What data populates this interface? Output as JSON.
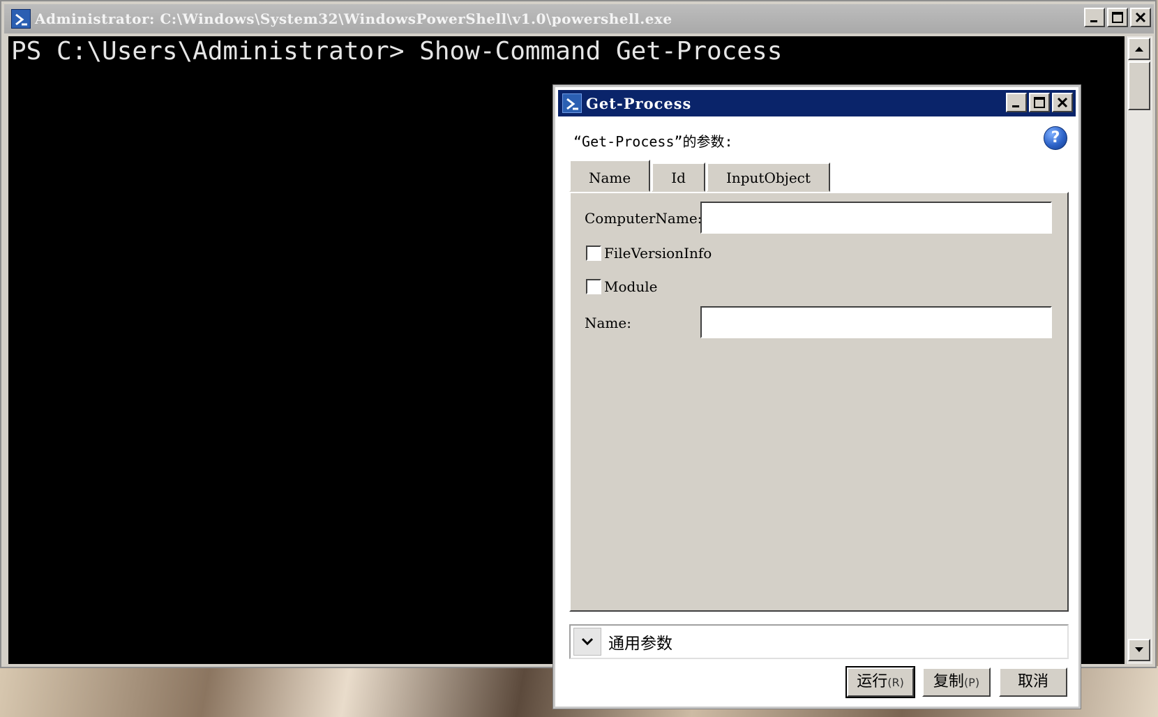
{
  "console_window": {
    "title": "Administrator: C:\\Windows\\System32\\WindowsPowerShell\\v1.0\\powershell.exe",
    "command_line": "PS C:\\Users\\Administrator> Show-Command Get-Process"
  },
  "dialog": {
    "title": "Get-Process",
    "heading": "“Get-Process”的参数:",
    "help_label": "?",
    "tabs": [
      {
        "label": "Name"
      },
      {
        "label": "Id"
      },
      {
        "label": "InputObject"
      }
    ],
    "fields": {
      "computer_name_label": "ComputerName:",
      "computer_name_value": "",
      "file_version_info_label": "FileVersionInfo",
      "module_label": "Module",
      "name_label": "Name:",
      "name_value": ""
    },
    "common_parameters_label": "通用参数",
    "buttons": {
      "run_label": "运行",
      "run_hotkey": "(R)",
      "copy_label": "复制",
      "copy_hotkey": "(P)",
      "cancel_label": "取消"
    }
  },
  "icons": [
    "powershell-icon",
    "minimize-icon",
    "maximize-icon",
    "close-icon",
    "help-icon",
    "chevron-down-icon",
    "scroll-up-icon",
    "scroll-down-icon"
  ]
}
